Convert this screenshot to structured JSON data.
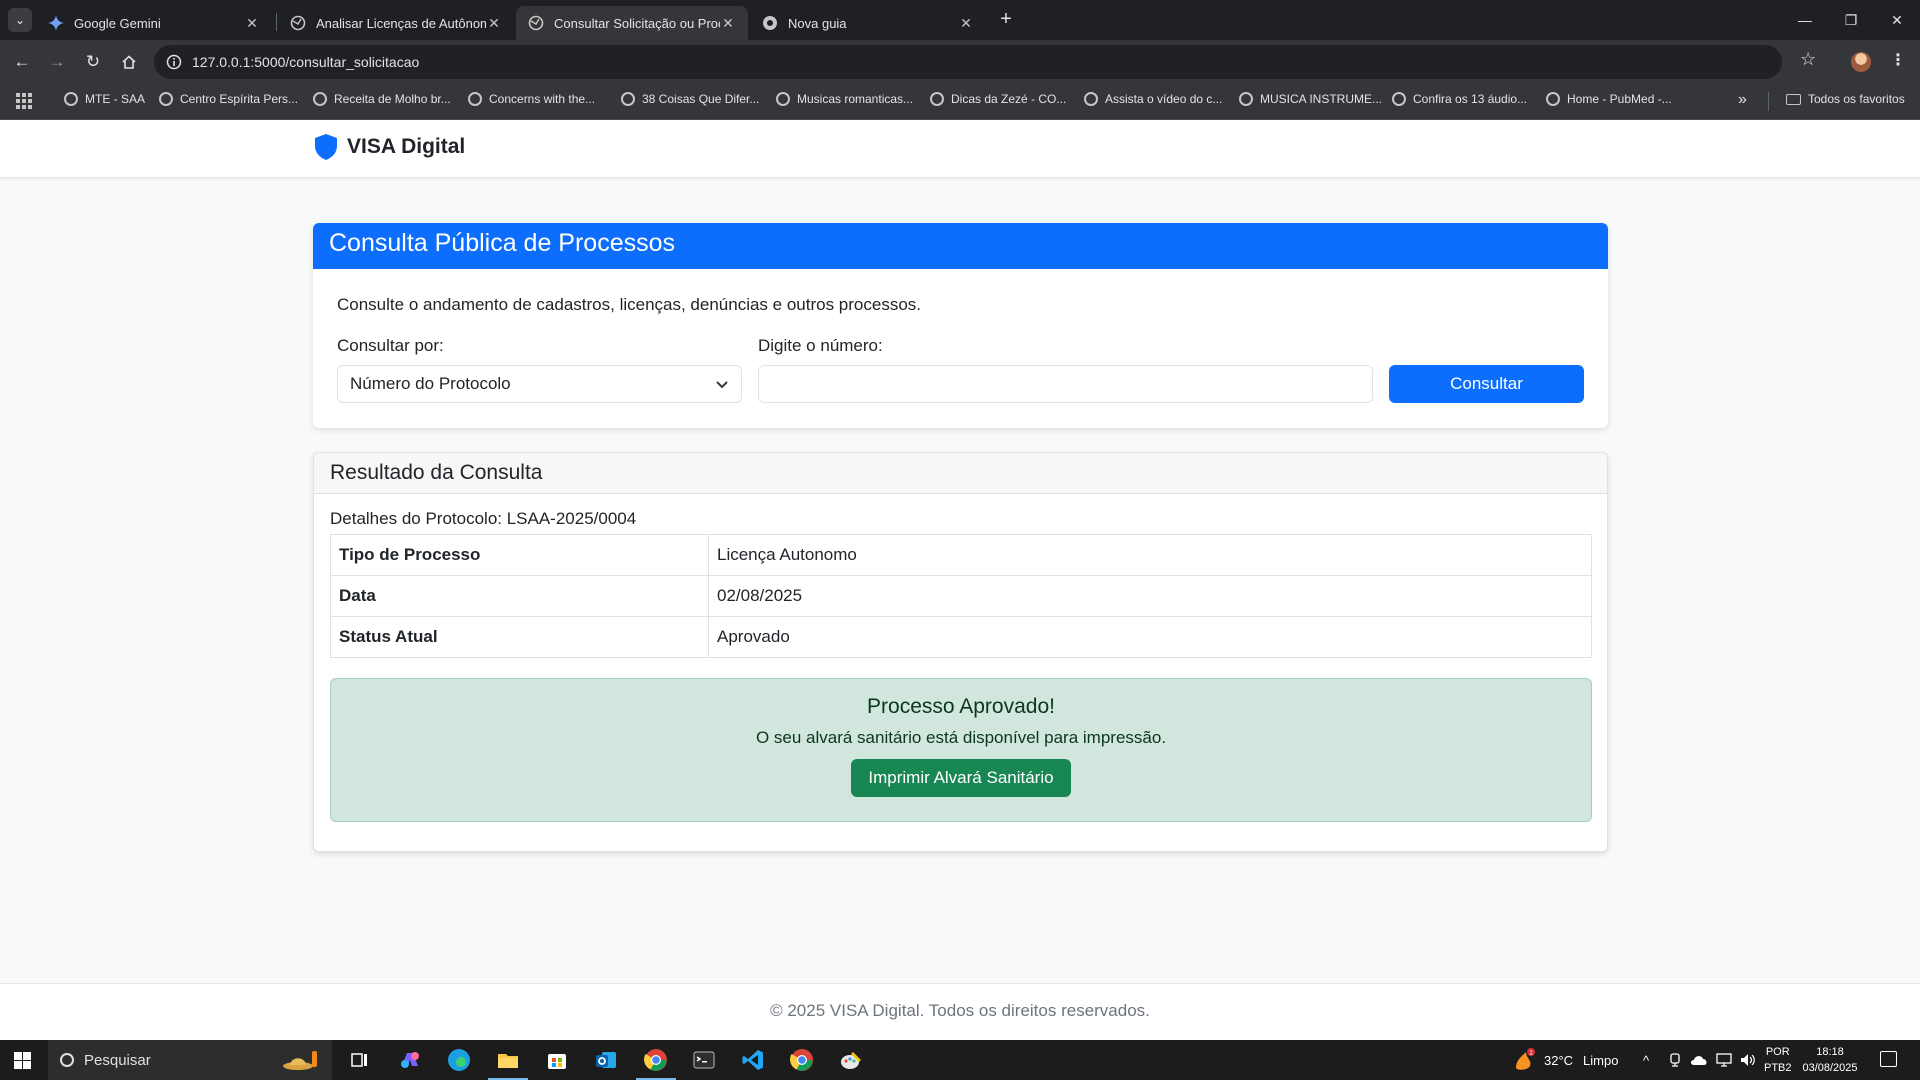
{
  "browser": {
    "tabs": [
      {
        "title": "Google Gemini",
        "icon": "gemini-icon"
      },
      {
        "title": "Analisar Licenças de Autônomo",
        "icon": "globe-icon"
      },
      {
        "title": "Consultar Solicitação ou Proces",
        "icon": "globe-icon",
        "active": true
      },
      {
        "title": "Nova guia",
        "icon": "chrome-icon"
      }
    ],
    "url": "127.0.0.1:5000/consultar_solicitacao",
    "bookmarks": [
      "MTE - SAA",
      "Centro Espírita Pers...",
      "Receita de Molho br...",
      "Concerns with the...",
      "38 Coisas Que Difer...",
      "Musicas romanticas...",
      "Dicas da Zezé - CO...",
      "Assista o vídeo do c...",
      "MUSICA INSTRUME...",
      "Confira os 13 áudio...",
      "Home - PubMed -..."
    ],
    "all_bookmarks_label": "Todos os favoritos"
  },
  "site": {
    "brand": "VISA Digital",
    "brand_color": "#0d6efd"
  },
  "search_card": {
    "title": "Consulta Pública de Processos",
    "lead": "Consulte o andamento de cadastros, licenças, denúncias e outros processos.",
    "consultar_por_label": "Consultar por:",
    "consultar_por_value": "Número do Protocolo",
    "numero_label": "Digite o número:",
    "numero_value": "",
    "button_label": "Consultar"
  },
  "result_card": {
    "title": "Resultado da Consulta",
    "protocol_line": "Detalhes do Protocolo: LSAA-2025/0004",
    "rows": [
      {
        "key": "Tipo de Processo",
        "value": "Licença Autonomo"
      },
      {
        "key": "Data",
        "value": "02/08/2025"
      },
      {
        "key": "Status Atual",
        "value": "Aprovado"
      }
    ],
    "alert_title": "Processo Aprovado!",
    "alert_message": "O seu alvará sanitário está disponível para impressão.",
    "print_button": "Imprimir Alvará Sanitário"
  },
  "footer": {
    "text": "© 2025 VISA Digital. Todos os direitos reservados."
  },
  "taskbar": {
    "search_placeholder": "Pesquisar",
    "weather_temp": "32°C",
    "weather_desc": "Limpo",
    "weather_badge": "1",
    "lang_1": "POR",
    "lang_2": "PTB2",
    "time": "18:18",
    "date": "03/08/2025"
  }
}
